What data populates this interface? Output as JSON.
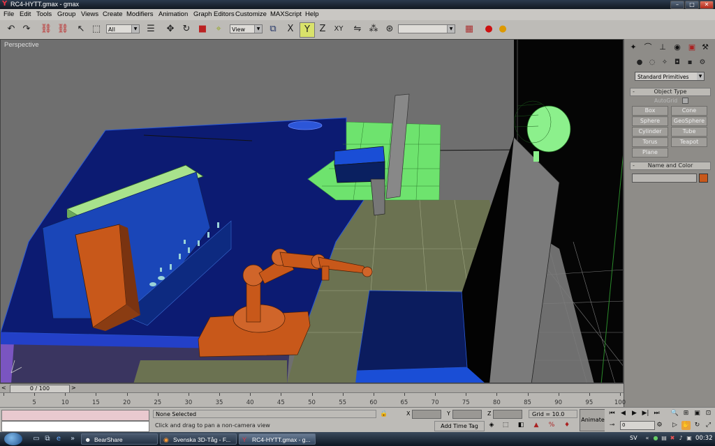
{
  "window": {
    "title": "RC4-HYTT.gmax - gmax",
    "minimize_label": "–",
    "maximize_label": "□",
    "close_label": "✕"
  },
  "menu": {
    "items": [
      "File",
      "Edit",
      "Tools",
      "Group",
      "Views",
      "Create",
      "Modifiers",
      "Animation",
      "Graph Editors",
      "Customize",
      "MAXScript",
      "Help"
    ]
  },
  "toolbar": {
    "selection_filter": "All",
    "reference_coord": "View",
    "named_selection": "",
    "axis_x": "X",
    "axis_y": "Y",
    "axis_z": "Z",
    "axis_xy": "XY"
  },
  "viewport": {
    "label": "Perspective"
  },
  "command_panel": {
    "category": "Standard Primitives",
    "object_type_title": "Object Type",
    "autogrid_label": "AutoGrid",
    "buttons": [
      "Box",
      "Cone",
      "Sphere",
      "GeoSphere",
      "Cylinder",
      "Tube",
      "Torus",
      "Teapot",
      "Plane"
    ],
    "name_color_title": "Name and Color",
    "object_color": "#c8581a"
  },
  "timeline": {
    "frame_display": "0 / 100",
    "ticks": [
      "0",
      "5",
      "10",
      "15",
      "20",
      "25",
      "30",
      "35",
      "40",
      "45",
      "50",
      "55",
      "60",
      "65",
      "70",
      "75",
      "80",
      "85",
      "90",
      "95",
      "100"
    ]
  },
  "status": {
    "selection": "None Selected",
    "prompt": "Click and drag to pan a non-camera view",
    "x_label": "X",
    "y_label": "Y",
    "z_label": "Z",
    "grid": "Grid = 10.0",
    "add_time_tag": "Add Time Tag",
    "animate": "Animate",
    "current_frame": "0"
  },
  "taskbar": {
    "tasks": [
      {
        "label": "BearShare",
        "active": false
      },
      {
        "label": "Svenska 3D-Tåg - F...",
        "active": false
      },
      {
        "label": "RC4-HYTT.gmax - g...",
        "active": true
      }
    ],
    "language": "SV",
    "clock": "00:32"
  },
  "colors": {
    "robot_orange": "#c8581a",
    "desk_blue": "#0f1f7a",
    "highlight_green": "#6ee36e",
    "floor_olive": "#6b7251"
  }
}
